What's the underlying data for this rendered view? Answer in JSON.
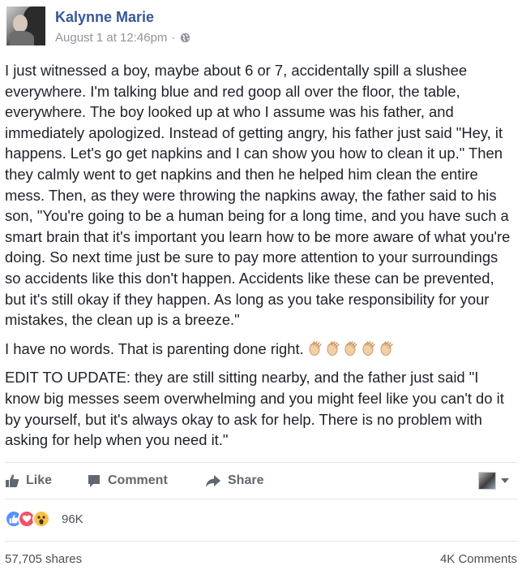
{
  "post": {
    "author": "Kalynne Marie",
    "timestamp": "August 1 at 12:46pm",
    "separator": "·",
    "privacy_icon": "globe-icon",
    "paragraphs": [
      "I just witnessed a boy, maybe about 6 or 7, accidentally spill a slushee everywhere. I'm talking blue and red goop all over the floor, the table, everywhere. The boy looked up at who I assume was his father, and immediately apologized. Instead of getting angry, his father just said \"Hey, it happens. Let's go get napkins and I can show you how to clean it up.\" Then they calmly went to get napkins and then he helped him clean the entire mess. Then, as they were throwing the napkins away, the father said to his son, \"You're going to be a human being for a long time, and you have such a smart brain that it's important you learn how to be more aware of what you're doing. So next time just be sure to pay more attention to your surroundings so accidents like this don't happen. Accidents like these can be prevented, but it's still okay if they happen. As long as you take responsibility for your mistakes, the clean up is a breeze.\"",
      "I have no words. That is parenting done right.",
      "EDIT TO UPDATE: they are still sitting nearby, and the father just said \"I know big messes seem overwhelming and you might feel like you can't do it by yourself, but it's always okay to ask for help. There is no problem with asking for help when you need it.\""
    ],
    "clap_emoji_count": 5
  },
  "actions": {
    "like": "Like",
    "comment": "Comment",
    "share": "Share"
  },
  "reactions": {
    "types": [
      "like",
      "love",
      "wow"
    ],
    "count": "96K"
  },
  "stats": {
    "shares": "57,705 shares",
    "comments": "4K Comments"
  },
  "colors": {
    "author_link": "#365899",
    "meta_gray": "#90949c",
    "action_gray": "#606770",
    "like_blue": "#5890ff",
    "love_red": "#f25268",
    "wow_yellow": "#f7c14c"
  }
}
